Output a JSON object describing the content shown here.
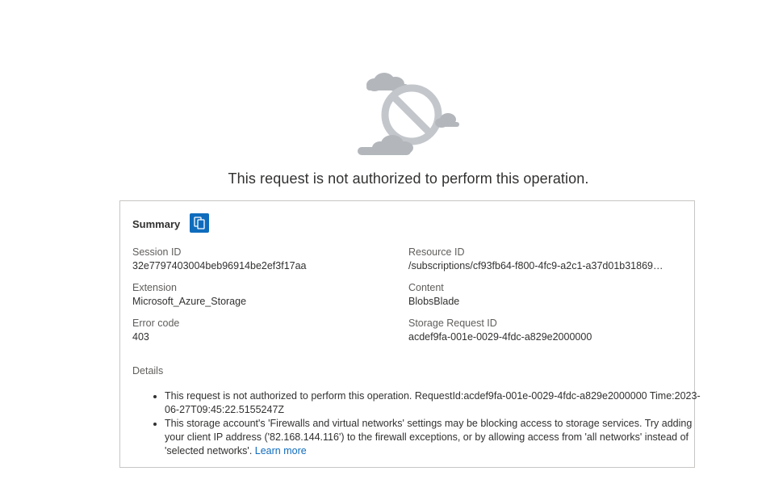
{
  "error": {
    "headline": "This request is not authorized to perform this operation."
  },
  "summary": {
    "title": "Summary",
    "copy_icon": "copy-icon",
    "fields": {
      "session_id": {
        "label": "Session ID",
        "value": "32e7797403004beb96914be2ef3f17aa"
      },
      "resource_id": {
        "label": "Resource ID",
        "value": "/subscriptions/cf93fb64-f800-4fc9-a2c1-a37d01b31869…"
      },
      "extension": {
        "label": "Extension",
        "value": "Microsoft_Azure_Storage"
      },
      "content": {
        "label": "Content",
        "value": "BlobsBlade"
      },
      "error_code": {
        "label": "Error code",
        "value": "403"
      },
      "storage_request_id": {
        "label": "Storage Request ID",
        "value": "acdef9fa-001e-0029-4fdc-a829e2000000"
      }
    },
    "details": {
      "label": "Details",
      "items": [
        {
          "text": "This request is not authorized to perform this operation. RequestId:acdef9fa-001e-0029-4fdc-a829e2000000 Time:2023-06-27T09:45:22.5155247Z"
        },
        {
          "text": "This storage account's 'Firewalls and virtual networks' settings may be blocking access to storage services. Try adding your client IP address ('82.168.144.116') to the firewall exceptions, or by allowing access from 'all networks' instead of 'selected networks'. ",
          "link": "Learn more"
        }
      ]
    }
  },
  "colors": {
    "accent": "#0f6cbd",
    "border": "#c8c6c4",
    "illustration_gray": "#bdc1c6"
  }
}
